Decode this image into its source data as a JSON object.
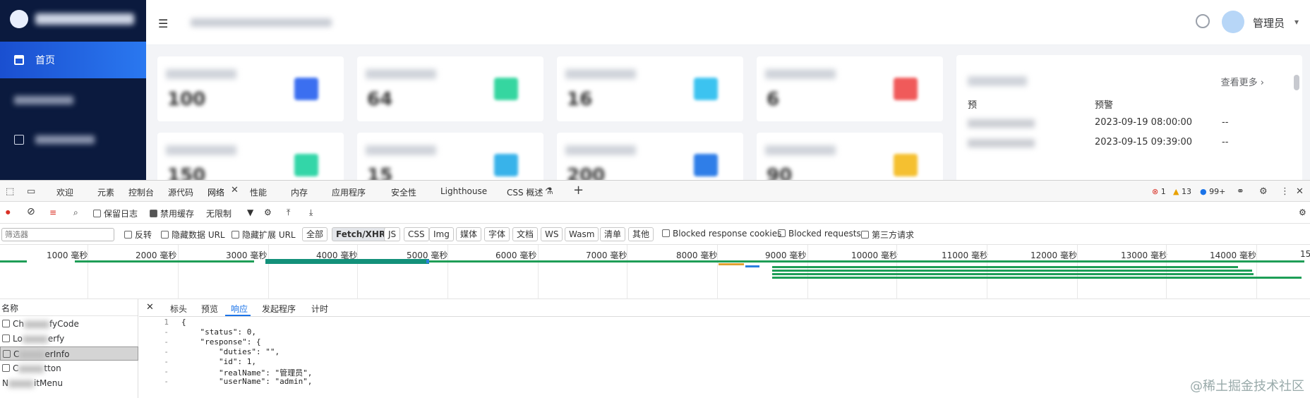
{
  "sidebar": {
    "items": [
      {
        "label": "首页",
        "icon": "home-icon"
      },
      {
        "label": "",
        "icon": "user-icon"
      },
      {
        "label": "",
        "icon": "monitor-icon"
      }
    ]
  },
  "header": {
    "user_name": "管理员"
  },
  "dashboard": {
    "cards": [
      {
        "number": "100",
        "icon_color": "#3b6ff0"
      },
      {
        "number": "64",
        "icon_color": "#35d6a0"
      },
      {
        "number": "16",
        "icon_color": "#3cc3f0"
      },
      {
        "number": "6",
        "icon_color": "#f05a5a"
      },
      {
        "number": "150",
        "icon_color": "#33d6a8"
      },
      {
        "number": "15",
        "icon_color": "#38b3ea"
      },
      {
        "number": "200",
        "icon_color": "#2f7ee8"
      },
      {
        "number": "90",
        "icon_color": "#f5c030"
      }
    ],
    "table": {
      "more_label": "查看更多",
      "rows": [
        {
          "col1": "预",
          "col2": "预警",
          "col3": ""
        },
        {
          "col1": "",
          "col2": "2023-09-19 08:00:00",
          "col3": "--"
        },
        {
          "col1": "",
          "col2": "2023-09-15 09:39:00",
          "col3": "--"
        }
      ]
    }
  },
  "devtools": {
    "tabs": [
      "欢迎",
      "元素",
      "控制台",
      "源代码",
      "网络",
      "性能",
      "内存",
      "应用程序",
      "安全性",
      "Lighthouse",
      "CSS 概述"
    ],
    "active_tab": "网络",
    "errors": "1",
    "warnings": "13",
    "infos": "99+",
    "toolbar": {
      "preserve_log": "保留日志",
      "disable_cache": "禁用缓存",
      "throttle": "无限制"
    },
    "filter": {
      "placeholder": "筛选器",
      "invert": "反转",
      "hide_data_urls": "隐藏数据 URL",
      "hide_ext_urls": "隐藏扩展 URL",
      "types": [
        "全部",
        "Fetch/XHR",
        "JS",
        "CSS",
        "Img",
        "媒体",
        "字体",
        "文档",
        "WS",
        "Wasm",
        "清单",
        "其他"
      ],
      "selected_type": "Fetch/XHR",
      "blocked_cookies": "Blocked response cookies",
      "blocked_requests": "Blocked requests",
      "third_party": "第三方请求"
    },
    "timeline_ticks": [
      "1000 毫秒",
      "2000 毫秒",
      "3000 毫秒",
      "4000 毫秒",
      "5000 毫秒",
      "6000 毫秒",
      "7000 毫秒",
      "8000 毫秒",
      "9000 毫秒",
      "10000 毫秒",
      "11000 毫秒",
      "12000 毫秒",
      "13000 毫秒",
      "14000 毫秒",
      "15"
    ],
    "request_list": {
      "header": "名称",
      "items": [
        {
          "prefix": "Ch",
          "suffix": "fyCode"
        },
        {
          "prefix": "Lo",
          "suffix": "erfy"
        },
        {
          "prefix": "C",
          "suffix": "erInfo"
        },
        {
          "prefix": "C",
          "suffix": "tton"
        },
        {
          "prefix": "N",
          "suffix": "itMenu"
        }
      ]
    },
    "detail_tabs": [
      "标头",
      "预览",
      "响应",
      "发起程序",
      "计时"
    ],
    "active_detail_tab": "响应",
    "response_lines": [
      {
        "n": "1",
        "text": "{"
      },
      {
        "n": "-",
        "text": "    \"status\": 0,"
      },
      {
        "n": "-",
        "text": "    \"response\": {"
      },
      {
        "n": "-",
        "text": "        \"duties\": \"\","
      },
      {
        "n": "-",
        "text": "        \"id\": 1,"
      },
      {
        "n": "-",
        "text": "        \"realName\": \"管理员\","
      },
      {
        "n": "-",
        "text": "        \"userName\": \"admin\","
      }
    ]
  },
  "watermark": "@稀土掘金技术社区"
}
